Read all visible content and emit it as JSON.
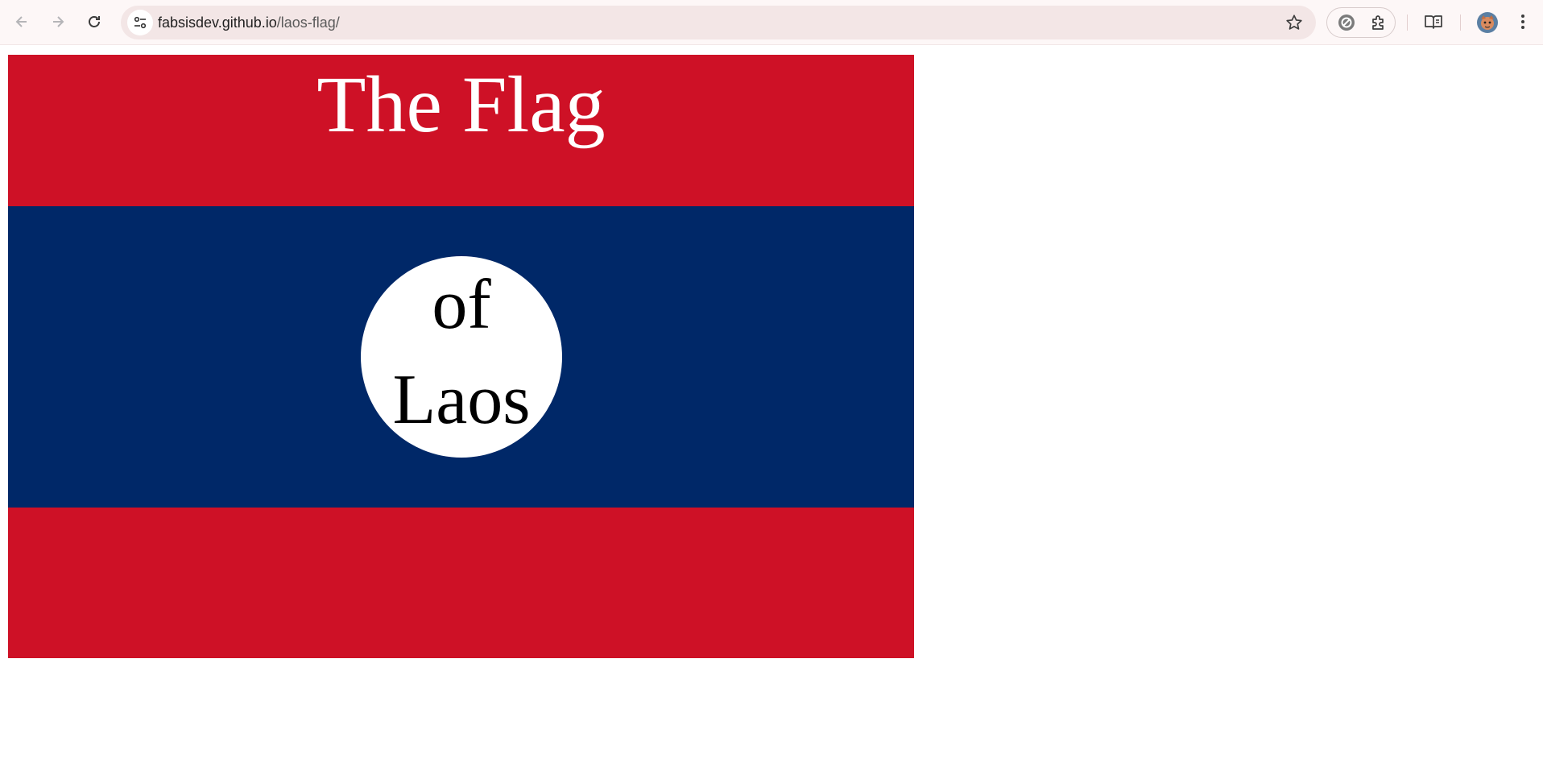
{
  "browser": {
    "back_icon": "arrow-left-icon",
    "forward_icon": "arrow-right-icon",
    "reload_icon": "reload-icon",
    "url_host": "fabsisdev.github.io",
    "url_path": "/laos-flag/",
    "bookmark_icon": "star-icon",
    "extensions_icon": "puzzle-icon",
    "reading_mode_icon": "book-icon",
    "menu_icon": "kebab-menu-icon"
  },
  "page": {
    "heading": "The Flag",
    "disc_line1": "of",
    "disc_line2": "Laos"
  },
  "colors": {
    "red": "#ce1126",
    "blue": "#002868",
    "white": "#ffffff"
  }
}
